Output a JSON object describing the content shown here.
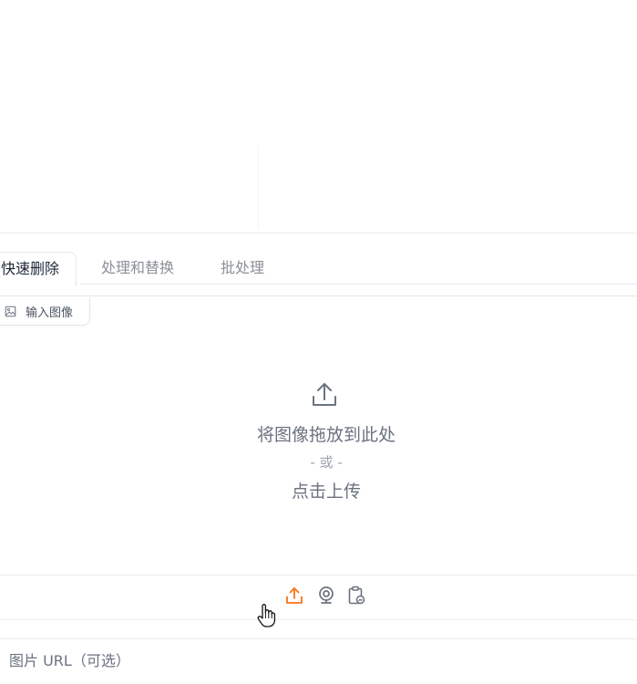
{
  "tabs": [
    {
      "label": "快速删除",
      "active": true
    },
    {
      "label": "处理和替换",
      "active": false
    },
    {
      "label": "批处理",
      "active": false
    }
  ],
  "input_image": {
    "label": "输入图像",
    "icon": "image-icon"
  },
  "drop_zone": {
    "icon": "upload-icon",
    "main_text": "将图像拖放到此处",
    "or_text": "- 或 -",
    "click_text": "点击上传"
  },
  "source_buttons": [
    {
      "name": "upload",
      "icon": "upload-icon",
      "color": "#f97316"
    },
    {
      "name": "webcam",
      "icon": "webcam-icon",
      "color": "#6b7280"
    },
    {
      "name": "clipboard",
      "icon": "clipboard-icon",
      "color": "#6b7280"
    }
  ],
  "url_field": {
    "placeholder": "图片 URL（可选）",
    "value": ""
  },
  "colors": {
    "accent": "#f97316",
    "border": "#e5e7eb",
    "muted_text": "#6b7280"
  }
}
